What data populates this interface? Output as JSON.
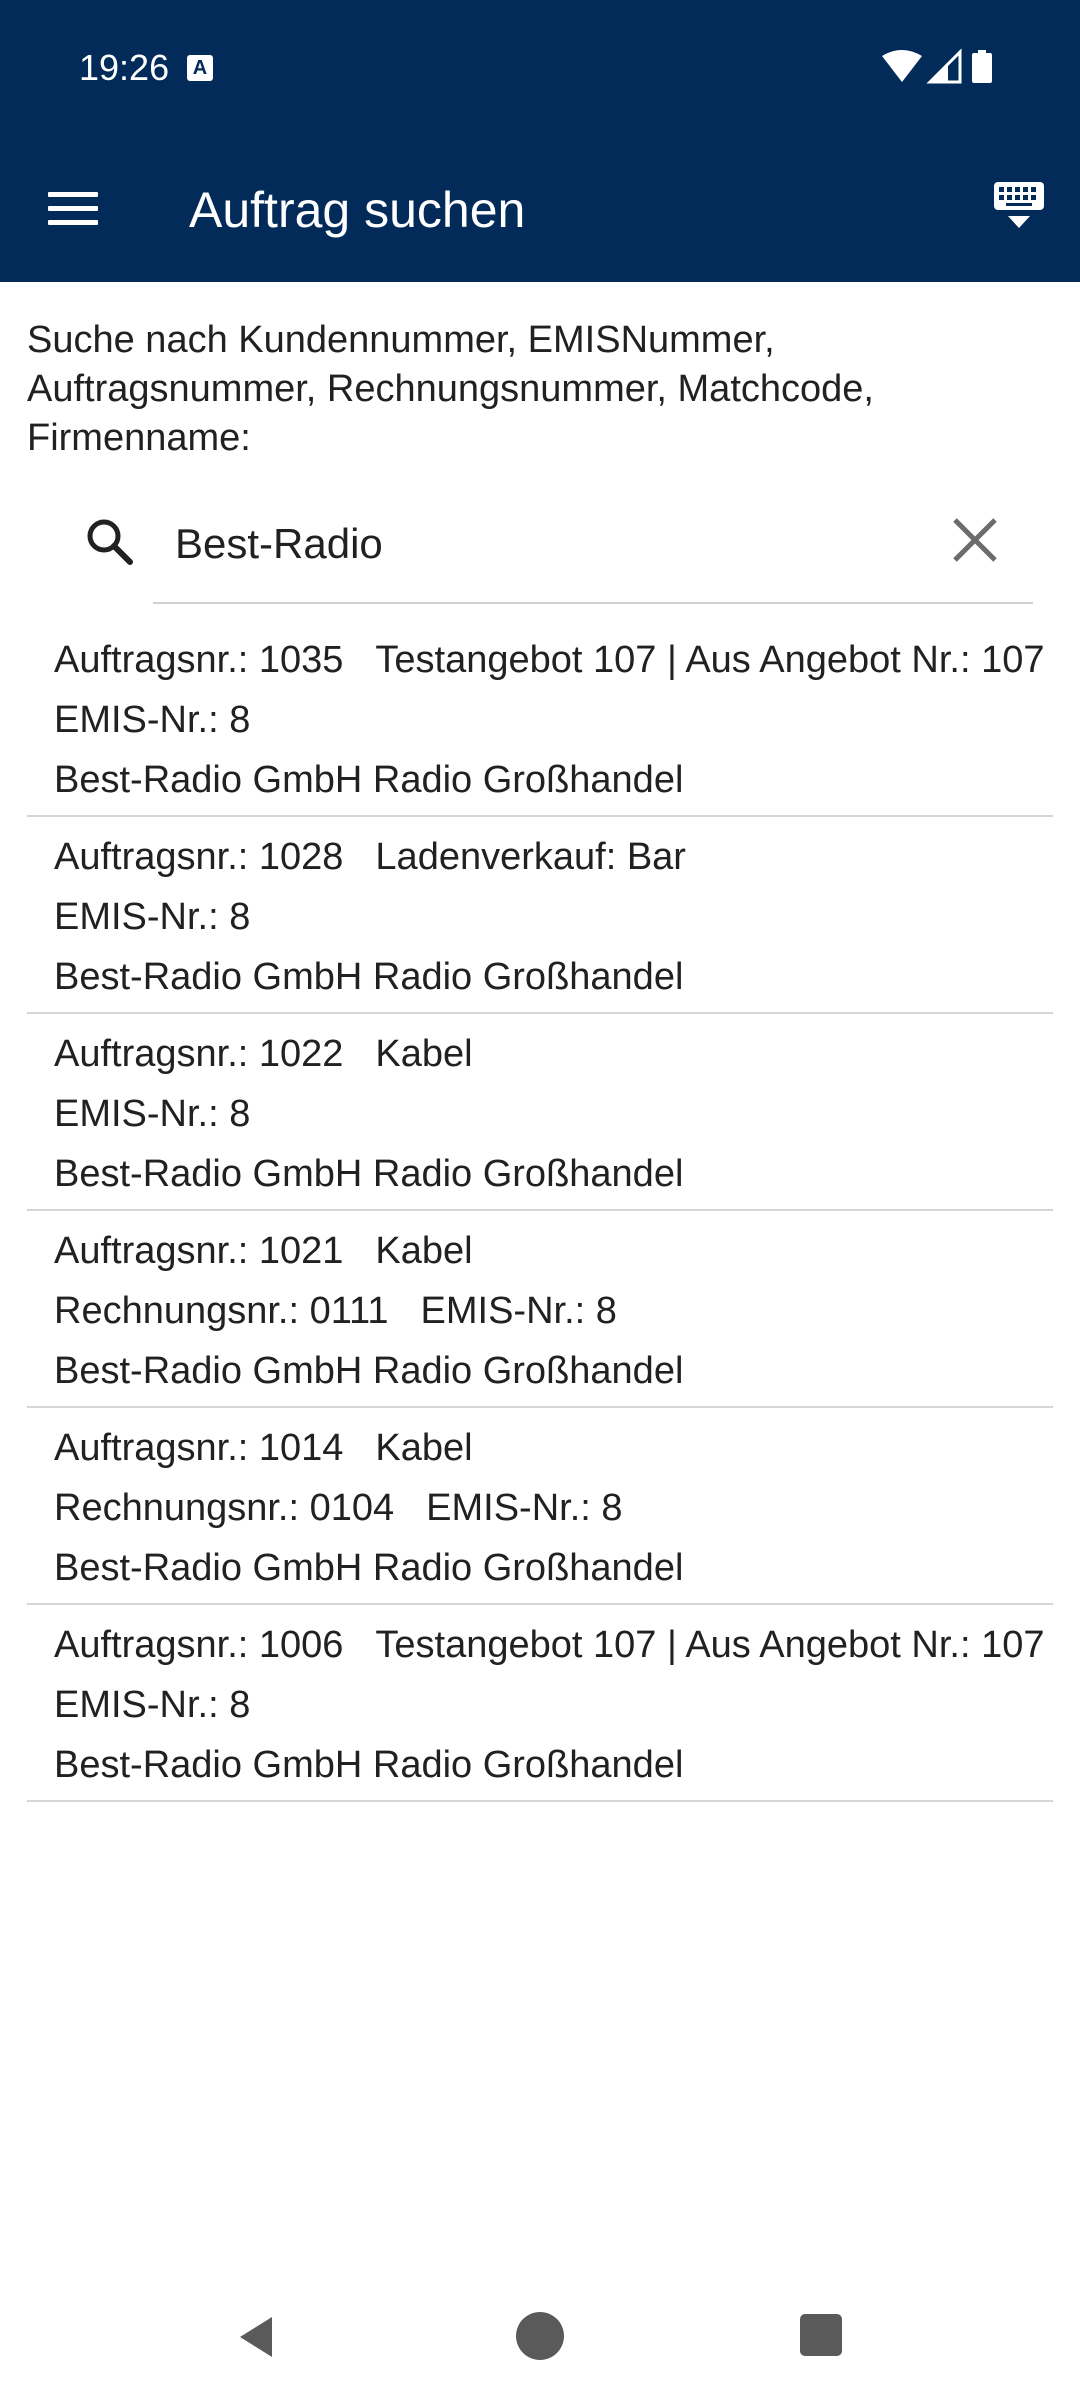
{
  "status_bar": {
    "time": "19:26",
    "icons": [
      "a-notification-icon",
      "wifi-icon",
      "signal-icon",
      "battery-icon"
    ]
  },
  "app_bar": {
    "title": "Auftrag suchen",
    "menu_icon": "hamburger-menu-icon",
    "keyboard_icon": "keyboard-hide-icon",
    "background": "#032b5a"
  },
  "search": {
    "hint": "Suche nach Kundennummer, EMISNummer, Auftragsnummer, Rechnungsnummer, Matchcode, Firmenname:",
    "value": "Best-Radio",
    "search_icon": "search-icon",
    "clear_icon": "close-icon"
  },
  "results": [
    {
      "order_label": "Auftragsnr.: 1035",
      "description": "Testangebot 107 | Aus Angebot Nr.: 107",
      "invoice_label": "",
      "emis_label": "EMIS-Nr.: 8",
      "company": "Best-Radio GmbH Radio Großhandel"
    },
    {
      "order_label": "Auftragsnr.: 1028",
      "description": "Ladenverkauf: Bar",
      "invoice_label": "",
      "emis_label": "EMIS-Nr.: 8",
      "company": "Best-Radio GmbH Radio Großhandel"
    },
    {
      "order_label": "Auftragsnr.: 1022",
      "description": "Kabel",
      "invoice_label": "",
      "emis_label": "EMIS-Nr.: 8",
      "company": "Best-Radio GmbH Radio Großhandel"
    },
    {
      "order_label": "Auftragsnr.: 1021",
      "description": "Kabel",
      "invoice_label": "Rechnungsnr.: 0111",
      "emis_label": "EMIS-Nr.: 8",
      "company": "Best-Radio GmbH Radio Großhandel"
    },
    {
      "order_label": "Auftragsnr.: 1014",
      "description": "Kabel",
      "invoice_label": "Rechnungsnr.: 0104",
      "emis_label": "EMIS-Nr.: 8",
      "company": "Best-Radio GmbH Radio Großhandel"
    },
    {
      "order_label": "Auftragsnr.: 1006",
      "description": "Testangebot 107 | Aus Angebot Nr.: 107",
      "invoice_label": "",
      "emis_label": "EMIS-Nr.: 8",
      "company": "Best-Radio GmbH Radio Großhandel"
    }
  ],
  "nav_bar": {
    "icons": [
      "back-icon",
      "home-icon",
      "recent-apps-icon"
    ]
  }
}
